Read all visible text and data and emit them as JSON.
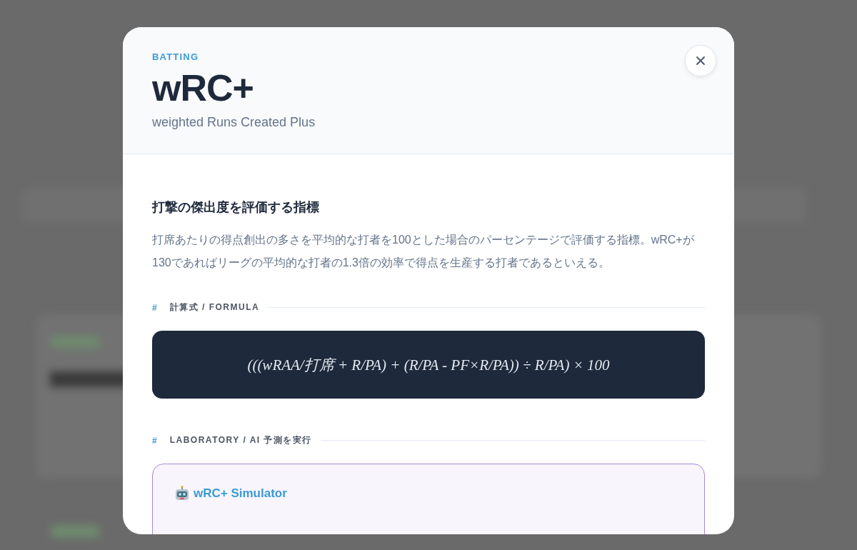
{
  "modal": {
    "category": "BATTING",
    "title": "wRC+",
    "subtitle": "weighted Runs Created Plus",
    "heading": "打撃の傑出度を評価する指標",
    "description": "打席あたりの得点創出の多さを平均的な打者を100とした場合のパーセンテージで評価する指標。wRC+が130であればリーグの平均的な打者の1.3倍の効率で得点を生産する打者であるといえる。",
    "sections": [
      {
        "kind": "formula",
        "marker": "#",
        "label": "計算式 / FORMULA",
        "formula": "(((wRAA/打席 + R/PA) + (R/PA - PF×R/PA)) ÷ R/PA) × 100"
      },
      {
        "kind": "lab",
        "marker": "#",
        "label": "LABORATORY / AI 予測を実行",
        "card_title": "wRC+ Simulator"
      }
    ]
  }
}
